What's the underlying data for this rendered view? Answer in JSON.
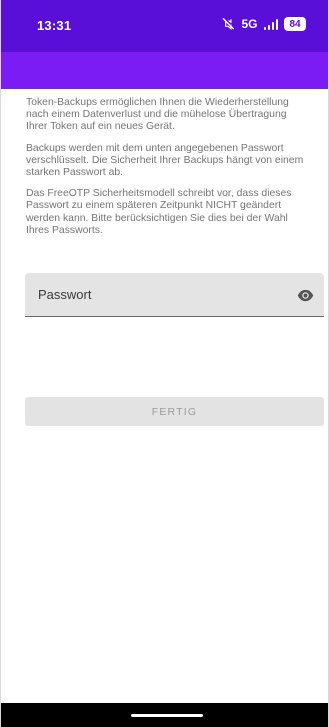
{
  "status_bar": {
    "time": "13:31",
    "network": "5G",
    "battery": "84",
    "icons": [
      "mute-icon",
      "signal-icon",
      "battery-icon"
    ]
  },
  "colors": {
    "status_bar": "#5a0fd9",
    "app_bar": "#7b1cf5",
    "body_text": "#757575",
    "field_bg": "#e4e4e4",
    "button_bg": "#e3e3e3"
  },
  "content": {
    "paragraphs": [
      "Token-Backups ermöglichen Ihnen die Wiederherstellung nach einem Datenverlust und die mühelose Übertragung Ihrer Token auf ein neues Gerät.",
      "Backups werden mit dem unten angegebenen Passwort verschlüsselt. Die Sicherheit Ihrer Backups hängt von einem starken Passwort ab.",
      "Das FreeOTP Sicherheitsmodell schreibt vor, dass dieses Passwort zu einem späteren Zeitpunkt NICHT geändert werden kann. Bitte berücksichtigen Sie dies bei der Wahl Ihres Passworts."
    ]
  },
  "password_field": {
    "label": "Passwort",
    "value": "",
    "icon": "eye-icon"
  },
  "done_button": {
    "label": "FERTIG",
    "enabled": false
  }
}
